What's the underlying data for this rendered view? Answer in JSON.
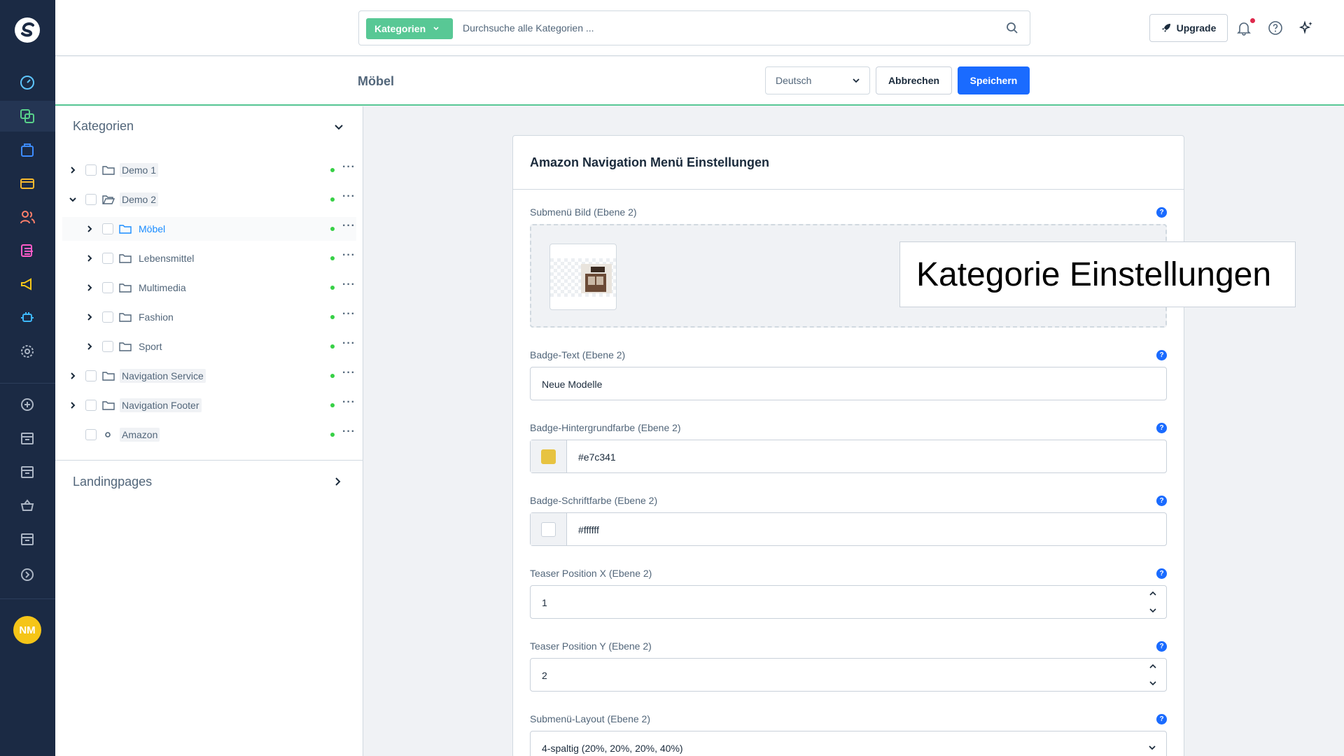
{
  "topbar": {
    "category_pill": "Kategorien",
    "search_placeholder": "Durchsuche alle Kategorien ...",
    "upgrade_label": "Upgrade"
  },
  "rail": {
    "avatar_initials": "NM",
    "icons": [
      "dashboard-icon",
      "catalog-icon",
      "orders-icon",
      "payment-icon",
      "customers-icon",
      "content-icon",
      "marketing-icon",
      "extensions-icon",
      "settings-icon",
      "add-icon",
      "sales-channel-icon",
      "sales-channel-icon",
      "basket-icon",
      "sales-channel-icon",
      "more-icon"
    ]
  },
  "actionbar": {
    "title": "Möbel",
    "language": "Deutsch",
    "cancel_label": "Abbrechen",
    "save_label": "Speichern"
  },
  "tree": {
    "header": "Kategorien",
    "items": [
      {
        "label": "Demo 1",
        "level": 0,
        "expander": "right",
        "icon": "folder"
      },
      {
        "label": "Demo 2",
        "level": 0,
        "expander": "down",
        "icon": "folder-open"
      },
      {
        "label": "Möbel",
        "level": 1,
        "expander": "right",
        "icon": "folder",
        "selected": true
      },
      {
        "label": "Lebensmittel",
        "level": 1,
        "expander": "right",
        "icon": "folder"
      },
      {
        "label": "Multimedia",
        "level": 1,
        "expander": "right",
        "icon": "folder"
      },
      {
        "label": "Fashion",
        "level": 1,
        "expander": "right",
        "icon": "folder"
      },
      {
        "label": "Sport",
        "level": 1,
        "expander": "right",
        "icon": "folder"
      },
      {
        "label": "Navigation Service",
        "level": 0,
        "expander": "right",
        "icon": "folder"
      },
      {
        "label": "Navigation Footer",
        "level": 0,
        "expander": "right",
        "icon": "folder"
      },
      {
        "label": "Amazon",
        "level": 0,
        "expander": "none",
        "icon": "link"
      }
    ],
    "landingpages": "Landingpages"
  },
  "card": {
    "title": "Amazon Navigation Menü Einstellungen",
    "fields": {
      "submenu_image_label": "Submenü Bild (Ebene 2)",
      "badge_text_label": "Badge-Text (Ebene 2)",
      "badge_text_value": "Neue Modelle",
      "badge_bg_label": "Badge-Hintergrundfarbe (Ebene 2)",
      "badge_bg_value": "#e7c341",
      "badge_font_label": "Badge-Schriftfarbe (Ebene 2)",
      "badge_font_value": "#ffffff",
      "teaser_x_label": "Teaser Position X (Ebene 2)",
      "teaser_x_value": "1",
      "teaser_y_label": "Teaser Position Y (Ebene 2)",
      "teaser_y_value": "2",
      "layout_label": "Submenü-Layout (Ebene 2)",
      "layout_value": "4-spaltig (20%, 20%, 20%, 40%)"
    },
    "help_glyph": "?"
  },
  "overlay": {
    "caption": "Kategorie Einstellungen"
  },
  "colors": {
    "rail_bg": "#1b2a44",
    "accent_green": "#58c895",
    "primary_blue": "#1a6bff",
    "status_dot": "#37d046",
    "badge_bg": "#e7c341"
  }
}
